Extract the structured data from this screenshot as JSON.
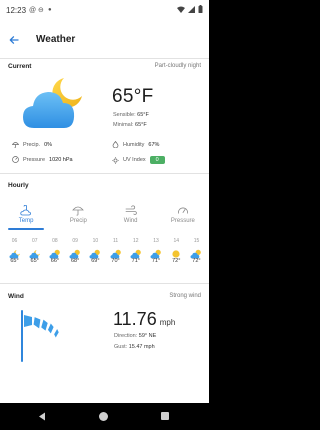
{
  "status_bar": {
    "time": "12:23",
    "icons": [
      "at-sign-icon",
      "no-disturb-icon",
      "notification-dot-icon",
      "wifi-icon",
      "signal-icon",
      "battery-icon"
    ]
  },
  "app_bar": {
    "title": "Weather",
    "back_icon": "back-arrow-icon"
  },
  "current": {
    "section_title": "Current",
    "condition": "Part-cloudly night",
    "icon": "cloud-moon-icon",
    "temperature": "65°F",
    "sensible_label": "Sensible:",
    "sensible_value": "65°F",
    "minimal_label": "Minimal:",
    "minimal_value": "65°F",
    "precip_label": "Precip.",
    "precip_value": "0%",
    "humidity_label": "Humidity",
    "humidity_value": "67%",
    "pressure_label": "Pressure",
    "pressure_value": "1020 hPa",
    "uv_label": "UV Index",
    "uv_value": "0",
    "uv_color": "#4caf64"
  },
  "hourly": {
    "section_title": "Hourly",
    "tabs": [
      {
        "label": "Temp",
        "icon": "thermometer-cloud-icon",
        "active": true
      },
      {
        "label": "Precip",
        "icon": "umbrella-icon",
        "active": false
      },
      {
        "label": "Wind",
        "icon": "wind-icon",
        "active": false
      },
      {
        "label": "Pressure",
        "icon": "gauge-icon",
        "active": false
      }
    ],
    "hours": [
      {
        "time": "06",
        "temp": "65°",
        "icon": "cloud-moon-icon"
      },
      {
        "time": "07",
        "temp": "65°",
        "icon": "cloud-moon-icon"
      },
      {
        "time": "08",
        "temp": "66°",
        "icon": "cloud-sun-icon"
      },
      {
        "time": "09",
        "temp": "68°",
        "icon": "cloud-sun-icon"
      },
      {
        "time": "10",
        "temp": "69°",
        "icon": "cloud-sun-icon"
      },
      {
        "time": "11",
        "temp": "70°",
        "icon": "cloud-sun-icon"
      },
      {
        "time": "12",
        "temp": "71°",
        "icon": "cloud-sun-icon"
      },
      {
        "time": "13",
        "temp": "71°",
        "icon": "cloud-sun-icon"
      },
      {
        "time": "14",
        "temp": "72°",
        "icon": "sun-icon"
      },
      {
        "time": "15",
        "temp": "72°",
        "icon": "cloud-sun-icon"
      }
    ]
  },
  "wind": {
    "section_title": "Wind",
    "condition": "Strong wind",
    "icon": "windsock-icon",
    "speed": "11.76",
    "unit": "mph",
    "direction_label": "Direction:",
    "direction_value": "59° NE",
    "gust_label": "Gust:",
    "gust_value": "15.47 mph"
  },
  "colors": {
    "accent": "#2e7cd6",
    "cloud": "#3d9ee8",
    "moon": "#f4c430",
    "uv_good": "#4caf64"
  }
}
